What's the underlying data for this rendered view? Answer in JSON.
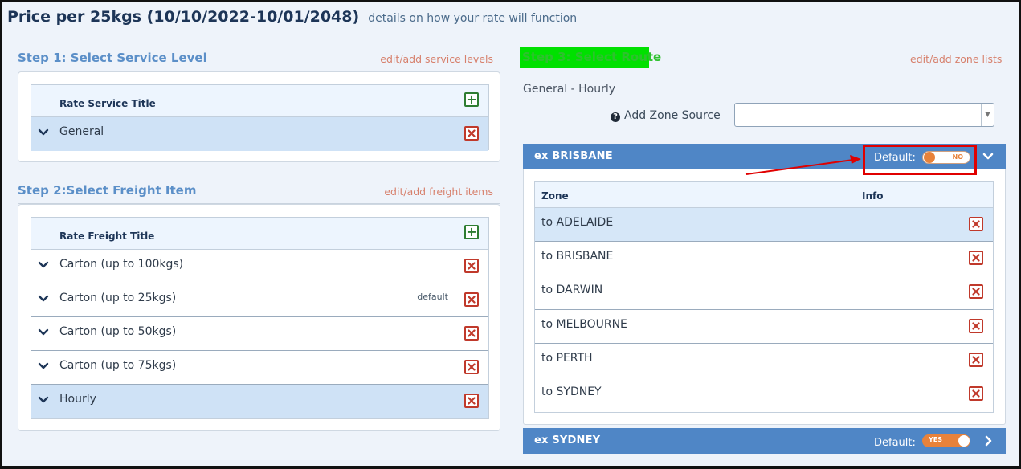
{
  "header": {
    "title": "Price per 25kgs (10/10/2022-10/01/2048)",
    "subtitle": "details on how your rate will function"
  },
  "step1": {
    "title": "Step 1: Select Service Level",
    "link": "edit/add service levels",
    "column_header": "Rate Service Title",
    "rows": [
      {
        "label": "General",
        "selected": true,
        "badge": ""
      }
    ]
  },
  "step2": {
    "title": "Step 2:Select Freight Item",
    "link": "edit/add freight items",
    "column_header": "Rate Freight Title",
    "rows": [
      {
        "label": "Carton (up to 100kgs)",
        "selected": false,
        "badge": ""
      },
      {
        "label": "Carton (up to 25kgs)",
        "selected": false,
        "badge": "default"
      },
      {
        "label": "Carton (up to 50kgs)",
        "selected": false,
        "badge": ""
      },
      {
        "label": "Carton (up to 75kgs)",
        "selected": false,
        "badge": ""
      },
      {
        "label": "Hourly",
        "selected": true,
        "badge": ""
      }
    ]
  },
  "step3": {
    "title": "Step 3: Select Route",
    "link": "edit/add zone lists",
    "selection_summary": "General - Hourly",
    "zone_source_label": "Add Zone Source",
    "zone_source_value": "",
    "routes": [
      {
        "name": "ex BRISBANE",
        "default_label": "Default:",
        "toggle_text": "NO",
        "toggle_on": false,
        "expanded": true,
        "columns": [
          "Zone",
          "Info"
        ],
        "zones": [
          {
            "label": "to ADELAIDE",
            "selected": true
          },
          {
            "label": "to BRISBANE",
            "selected": false
          },
          {
            "label": "to DARWIN",
            "selected": false
          },
          {
            "label": "to MELBOURNE",
            "selected": false
          },
          {
            "label": "to PERTH",
            "selected": false
          },
          {
            "label": "to SYDNEY",
            "selected": false
          }
        ]
      },
      {
        "name": "ex SYDNEY",
        "default_label": "Default:",
        "toggle_text": "YES",
        "toggle_on": true,
        "expanded": false
      }
    ]
  },
  "colors": {
    "accent_blue": "#5b8fc8",
    "route_bar": "#4f86c6",
    "link_orange": "#d7806c",
    "toggle_orange": "#e8823a",
    "delete_red": "#c0392b",
    "add_green": "#2e7d32",
    "highlight_green": "#00e000",
    "annotation_red": "#e00000"
  },
  "icons": {
    "add": "plus-square-icon",
    "delete": "x-square-icon",
    "row_expand": "chevron-down-icon",
    "route_collapse": "chevron-down-icon",
    "route_expand": "chevron-right-icon",
    "help": "question-circle-icon"
  }
}
